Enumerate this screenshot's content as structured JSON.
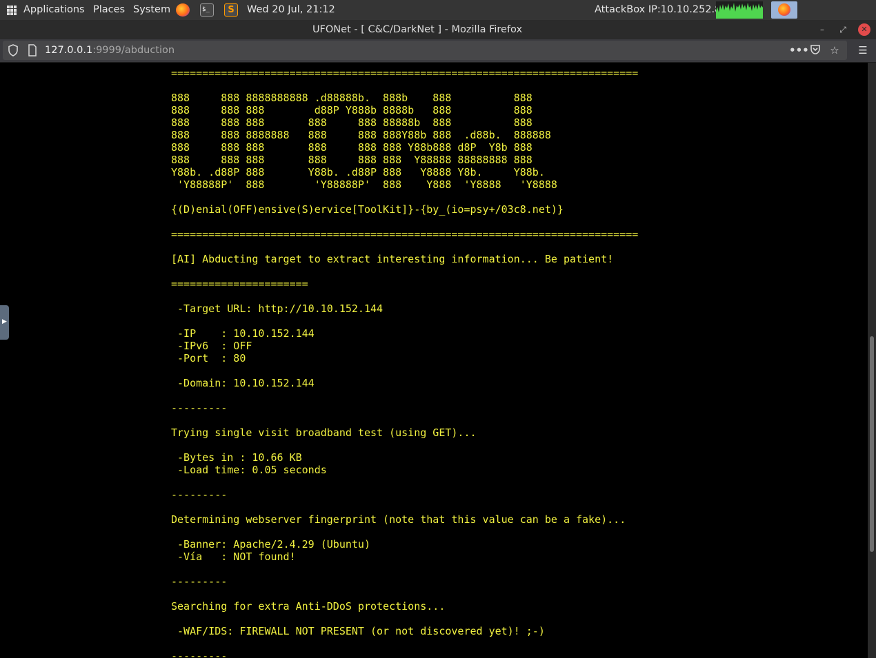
{
  "panel": {
    "applications": "Applications",
    "places": "Places",
    "system": "System",
    "clock": "Wed 20 Jul, 21:12",
    "ip_label": "AttackBox IP:10.10.252.80",
    "terminal_glyph": "$_"
  },
  "window": {
    "title": "UFONet - [ C&C/DarkNet ] - Mozilla Firefox"
  },
  "browser": {
    "url_host": "127.0.0.1",
    "url_rest": ":9999/abduction"
  },
  "terminal": {
    "lines": [
      "===========================================================================",
      "",
      "888     888 8888888888 .d88888b.  888b    888          888",
      "888     888 888        d88P Y888b 8888b   888          888",
      "888     888 888       888     888 88888b  888          888",
      "888     888 8888888   888     888 888Y88b 888  .d88b.  888888",
      "888     888 888       888     888 888 Y88b888 d8P  Y8b 888",
      "888     888 888       888     888 888  Y88888 88888888 888",
      "Y88b. .d88P 888       Y88b. .d88P 888   Y8888 Y8b.     Y88b.",
      " 'Y88888P'  888        'Y88888P'  888    Y888  'Y8888   'Y8888",
      "",
      "{(D)enial(OFF)ensive(S)ervice[ToolKit]}-{by_(io=psy+/03c8.net)}",
      "",
      "===========================================================================",
      "",
      "[AI] Abducting target to extract interesting information... Be patient!",
      "",
      "======================",
      "",
      " -Target URL: http://10.10.152.144",
      "",
      " -IP    : 10.10.152.144",
      " -IPv6  : OFF",
      " -Port  : 80",
      "",
      " -Domain: 10.10.152.144",
      "",
      "---------",
      "",
      "Trying single visit broadband test (using GET)...",
      "",
      " -Bytes in : 10.66 KB",
      " -Load time: 0.05 seconds",
      "",
      "---------",
      "",
      "Determining webserver fingerprint (note that this value can be a fake)...",
      "",
      " -Banner: Apache/2.4.29 (Ubuntu)",
      " -Vía   : NOT found!",
      "",
      "---------",
      "",
      "Searching for extra Anti-DDoS protections...",
      "",
      " -WAF/IDS: FIREWALL NOT PRESENT (or not discovered yet)! ;-)",
      "",
      "---------"
    ]
  },
  "colors": {
    "terminal_text": "#f1f140",
    "background": "#000000",
    "close_button": "#e24b4b"
  },
  "icons": {
    "apps": "grid-icon",
    "firefox": "firefox-icon",
    "terminal": "terminal-icon",
    "sublime": "sublime-text-icon",
    "shield": "tracking-protection-icon",
    "page": "page-info-icon",
    "more": "more-actions-icon",
    "pocket": "pocket-icon",
    "bookmark": "bookmark-star-icon",
    "menu": "hamburger-menu-icon"
  }
}
